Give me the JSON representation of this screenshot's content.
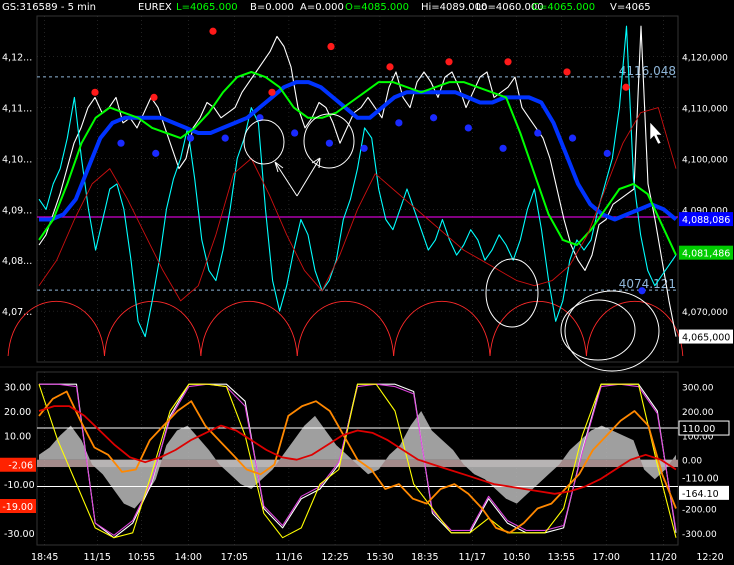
{
  "header": {
    "symbol": "GS:316589 - 5 min",
    "exchange": "EUREX",
    "last": "L=4065.000",
    "bid": "B=0.000",
    "ask": "A=0.000",
    "open": "O=4085.000",
    "high": "Hi=4089.000",
    "low": "Lo=4060.000",
    "close": "C=4065.000",
    "volume": "V=4065",
    "colors": {
      "text": "#ffffff",
      "last": "#00ff00",
      "open": "#00ff00",
      "close": "#00ff00"
    }
  },
  "chart_data": [
    {
      "panel": "price",
      "type": "line",
      "ylim": [
        4060,
        4128
      ],
      "ticks_left": [
        "4,12...",
        "4,11...",
        "4,10...",
        "4,09...",
        "4,08...",
        "4,07..."
      ],
      "ticks_left_values": [
        4120,
        4110,
        4100,
        4090,
        4080,
        4070
      ],
      "ticks_right": [
        "4,120,000",
        "4,110,000",
        "4,100,000",
        "4,090,000",
        "4,070,000"
      ],
      "ticks_right_values": [
        4120,
        4110,
        4100,
        4090,
        4070
      ],
      "value_labels": [
        {
          "text": "4116.048",
          "value": 4116.048,
          "line_color": "#8fb6d8"
        },
        {
          "text": "4074.121",
          "value": 4074.121,
          "line_color": "#8fb6d8"
        }
      ],
      "badges": [
        {
          "text": "4,088,086",
          "value": 4088.086,
          "bg": "#0000ff",
          "fg": "#ffffff"
        },
        {
          "text": "4,081,486",
          "value": 4081.486,
          "bg": "#00cc00",
          "fg": "#ffffff"
        },
        {
          "text": "4,065,000",
          "value": 4065.0,
          "bg": "#ffffff",
          "fg": "#000000"
        }
      ],
      "hline_magenta": 4088.5,
      "series": [
        {
          "color": "#ffffff",
          "role": "price",
          "values": [
            4083,
            4085,
            4089,
            4093,
            4098,
            4103,
            4106,
            4110,
            4112,
            4109,
            4110,
            4112,
            4107,
            4108,
            4106,
            4109,
            4112,
            4110,
            4106,
            4102,
            4098,
            4100,
            4106,
            4108,
            4111,
            4110,
            4108,
            4109,
            4110,
            4113,
            4115,
            4117,
            4119,
            4121,
            4124,
            4122,
            4118,
            4110,
            4106,
            4108,
            4111,
            4110,
            4107,
            4103,
            4106,
            4109,
            4110,
            4112,
            4110,
            4108,
            4114,
            4117,
            4112,
            4110,
            4115,
            4117,
            4115,
            4112,
            4116,
            4117,
            4114,
            4110,
            4113,
            4116,
            4117,
            4112,
            4113,
            4114,
            4116,
            4110,
            4108,
            4106,
            4104,
            4100,
            4094,
            4088,
            4083,
            4080,
            4078,
            4081,
            4087,
            4088,
            4091,
            4092,
            4093,
            4094,
            4126,
            4095,
            4088,
            4080,
            4072,
            4065
          ]
        },
        {
          "color": "#00ffff",
          "role": "fast",
          "values": [
            4092,
            4090,
            4095,
            4098,
            4104,
            4112,
            4100,
            4090,
            4082,
            4088,
            4094,
            4095,
            4090,
            4080,
            4068,
            4065,
            4072,
            4080,
            4090,
            4096,
            4100,
            4106,
            4096,
            4084,
            4078,
            4076,
            4082,
            4090,
            4100,
            4104,
            4110,
            4107,
            4090,
            4076,
            4070,
            4075,
            4082,
            4088,
            4085,
            4078,
            4074,
            4076,
            4080,
            4088,
            4092,
            4098,
            4106,
            4104,
            4094,
            4088,
            4086,
            4090,
            4094,
            4090,
            4086,
            4082,
            4084,
            4088,
            4084,
            4081,
            4083,
            4086,
            4084,
            4080,
            4082,
            4085,
            4083,
            4080,
            4084,
            4090,
            4094,
            4086,
            4076,
            4068,
            4072,
            4080,
            4084,
            4082,
            4084,
            4090,
            4095,
            4100,
            4110,
            4126,
            4096,
            4085,
            4078,
            4075,
            4077,
            4079,
            4081
          ]
        },
        {
          "color": "#0033ff",
          "role": "slow",
          "values": [
            4088,
            4088,
            4089,
            4092,
            4098,
            4104,
            4107,
            4108,
            4108,
            4108,
            4108,
            4107,
            4106,
            4105,
            4105,
            4106,
            4107,
            4108,
            4110,
            4112,
            4114,
            4115,
            4115,
            4114,
            4112,
            4110,
            4108,
            4108,
            4110,
            4112,
            4113,
            4113,
            4113,
            4113,
            4113,
            4112,
            4111,
            4111,
            4112,
            4112,
            4112,
            4111,
            4107,
            4101,
            4095,
            4091,
            4089,
            4088,
            4089,
            4090,
            4091,
            4090,
            4088
          ]
        },
        {
          "color": "#00ff00",
          "role": "medium",
          "values": [
            4084,
            4088,
            4095,
            4103,
            4108,
            4110,
            4109,
            4108,
            4106,
            4105,
            4104,
            4106,
            4109,
            4113,
            4116,
            4117,
            4116,
            4114,
            4110,
            4108,
            4108,
            4109,
            4111,
            4113,
            4115,
            4115,
            4114,
            4113,
            4114,
            4115,
            4115,
            4114,
            4113,
            4112,
            4105,
            4097,
            4089,
            4084,
            4083,
            4086,
            4090,
            4094,
            4095,
            4093,
            4087,
            4081
          ]
        },
        {
          "color": "#cc1010",
          "role": "cycle",
          "values": [
            4075,
            4080,
            4088,
            4095,
            4098,
            4092,
            4085,
            4078,
            4072,
            4075,
            4085,
            4097,
            4100,
            4093,
            4085,
            4078,
            4074,
            4081,
            4090,
            4097,
            4094,
            4091,
            4088,
            4085,
            4082,
            4080,
            4078,
            4076,
            4075,
            4076,
            4079,
            4085,
            4094,
            4103,
            4109,
            4110,
            4098
          ]
        }
      ],
      "red_dots": [
        4113,
        4112,
        4125,
        4113,
        4122,
        4118,
        4119,
        4119,
        4117,
        4114
      ],
      "blue_dots": [
        4103,
        4101,
        4104,
        4104,
        4108,
        4105,
        4103,
        4102,
        4107,
        4108,
        4106,
        4102,
        4105,
        4104,
        4101,
        4074
      ]
    },
    {
      "panel": "oscillator",
      "type": "area",
      "ylim": [
        -35,
        36
      ],
      "ticks_left": [
        "30.00",
        "20.00",
        "10.00",
        "-10.00",
        "-30.00"
      ],
      "ticks_left_values": [
        30,
        20,
        10,
        -10,
        -30
      ],
      "ticks_right": [
        "300.00",
        "200.00",
        "100.00",
        "0.00",
        "-200.00",
        "-300.00"
      ],
      "ticks_right_values": [
        30,
        20,
        10,
        0,
        -20,
        -30
      ],
      "badges_left": [
        {
          "text": "-2.06",
          "value": -2.06,
          "bg": "#ff2200",
          "fg": "#ffffff"
        },
        {
          "text": "-19.00",
          "value": -19.0,
          "bg": "#ff2200",
          "fg": "#ffffff"
        }
      ],
      "badges_right": [
        {
          "text": "110.00",
          "value": 13,
          "bg": "#000000",
          "fg": "#ffffff",
          "border": "#ffffff"
        },
        {
          "text": "-110.00",
          "value": -7.2,
          "bg": "#000000",
          "fg": "#ffffff"
        },
        {
          "text": "-164.10",
          "value": -13.6,
          "bg": "#ffffff",
          "fg": "#000000"
        }
      ],
      "hlines_white": [
        13,
        -11
      ],
      "zero_band": [
        0,
        -3
      ],
      "series": [
        {
          "color": "#bbbbbb",
          "role": "histogram",
          "values": [
            2,
            5,
            10,
            14,
            8,
            -2,
            -6,
            -12,
            -18,
            -20,
            -15,
            -8,
            6,
            12,
            14,
            9,
            4,
            -2,
            -6,
            -10,
            -12,
            -8,
            -4,
            2,
            8,
            14,
            18,
            12,
            6,
            2,
            -2,
            -6,
            -4,
            2,
            6,
            14,
            20,
            12,
            8,
            4,
            -2,
            -6,
            -8,
            -12,
            -16,
            -18,
            -14,
            -10,
            -6,
            -2,
            4,
            8,
            12,
            14,
            12,
            10,
            8,
            -4,
            -8,
            -4,
            2
          ]
        },
        {
          "color": "#ffffff",
          "role": "cycle-envelope",
          "values": [
            31,
            31,
            31,
            -26,
            -32,
            -26,
            -10,
            18,
            31,
            31,
            31,
            24,
            -20,
            -28,
            -16,
            -12,
            -2,
            31,
            31,
            31,
            28,
            -22,
            -30,
            -30,
            -16,
            -26,
            -30,
            -30,
            -28,
            4,
            31,
            31,
            31,
            20,
            -30
          ]
        },
        {
          "color": "#dd44dd",
          "role": "cycle",
          "values": [
            31,
            31,
            30,
            -26,
            -31,
            -25,
            -9,
            17,
            30,
            31,
            30,
            22,
            -19,
            -27,
            -15,
            -11,
            -1,
            30,
            31,
            30,
            27,
            -21,
            -29,
            -29,
            -15,
            -25,
            -29,
            -29,
            -27,
            3,
            30,
            31,
            30,
            19,
            -29
          ]
        },
        {
          "color": "#ffff00",
          "role": "fast-osc",
          "values": [
            31,
            8,
            -10,
            -28,
            -32,
            -30,
            -6,
            20,
            31,
            31,
            30,
            10,
            -22,
            -32,
            -28,
            -10,
            -4,
            31,
            31,
            20,
            -10,
            -20,
            -30,
            -30,
            -24,
            -30,
            -30,
            -30,
            -20,
            10,
            31,
            31,
            31,
            -2,
            -32
          ]
        },
        {
          "color": "#ff8800",
          "role": "signal",
          "values": [
            18,
            25,
            28,
            16,
            5,
            2,
            -5,
            -4,
            8,
            14,
            20,
            24,
            14,
            8,
            2,
            -4,
            -6,
            -2,
            18,
            22,
            24,
            20,
            10,
            0,
            -4,
            -12,
            -10,
            -16,
            -18,
            -12,
            -10,
            -14,
            -20,
            -28,
            -30,
            -26,
            -20,
            -18,
            -12,
            -6,
            4,
            10,
            16,
            20,
            14,
            -6,
            -20
          ]
        },
        {
          "color": "#dd0000",
          "role": "slow-signal",
          "values": [
            20,
            22,
            22,
            18,
            12,
            6,
            1,
            -1,
            1,
            4,
            8,
            11,
            14,
            12,
            8,
            4,
            1,
            0,
            2,
            6,
            10,
            12,
            11,
            8,
            4,
            0,
            -2,
            -4,
            -6,
            -8,
            -10,
            -11,
            -12,
            -13,
            -14,
            -13,
            -11,
            -8,
            -4,
            0,
            2,
            0,
            -4
          ]
        }
      ]
    }
  ],
  "x_axis": {
    "labels": [
      "18:45",
      "11/15",
      "10:55",
      "14:00",
      "17:05",
      "11/16",
      "12:25",
      "15:30",
      "18:35",
      "11/17",
      "10:50",
      "13:55",
      "17:00",
      "11/20",
      "12:20"
    ],
    "label_fractions": [
      0.012,
      0.094,
      0.163,
      0.236,
      0.308,
      0.393,
      0.465,
      0.535,
      0.605,
      0.679,
      0.748,
      0.818,
      0.888,
      0.977,
      1.05
    ]
  },
  "annotations": [
    {
      "type": "ellipse-group",
      "role": "circled-lows"
    },
    {
      "type": "arrows",
      "role": "pointers"
    },
    {
      "type": "cursor",
      "role": "mouse-pointer"
    }
  ],
  "colors": {
    "background": "#000000",
    "grid": "#444444",
    "axis_text": "#ffffff",
    "dashed_level": "#8fb6d8",
    "cycle_arcs": "#ff2a2a",
    "magenta_level": "#cc00cc"
  }
}
